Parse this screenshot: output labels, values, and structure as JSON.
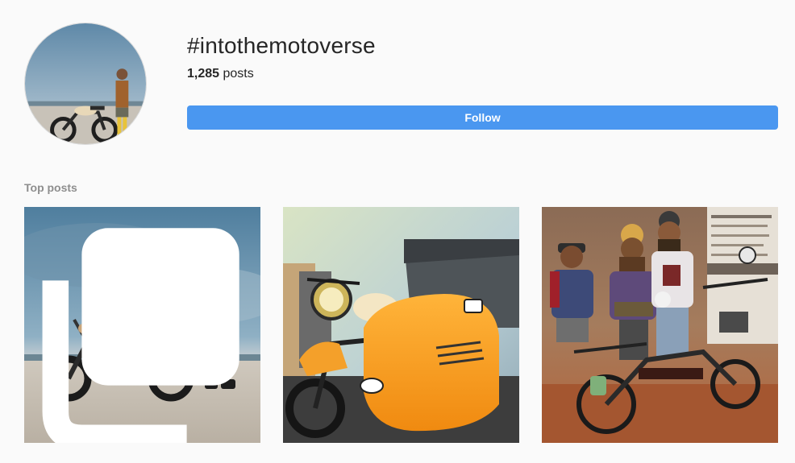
{
  "header": {
    "hashtag": "#intothemotoverse",
    "post_count": "1,285",
    "post_count_suffix": " posts",
    "follow_label": "Follow"
  },
  "sections": {
    "top_posts_title": "Top posts"
  },
  "top_posts": [
    {
      "image": "rider-with-motorcycle-on-beach",
      "multiple_photos": true
    },
    {
      "image": "vintage-motorcycle-with-orange-sidecar",
      "multiple_photos": false
    },
    {
      "image": "three-men-with-mopeds-at-event",
      "multiple_photos": false
    }
  ],
  "colors": {
    "background": "#fafafa",
    "follow_button": "#4a97f0",
    "text": "#262626",
    "muted": "#8e8e8e"
  }
}
